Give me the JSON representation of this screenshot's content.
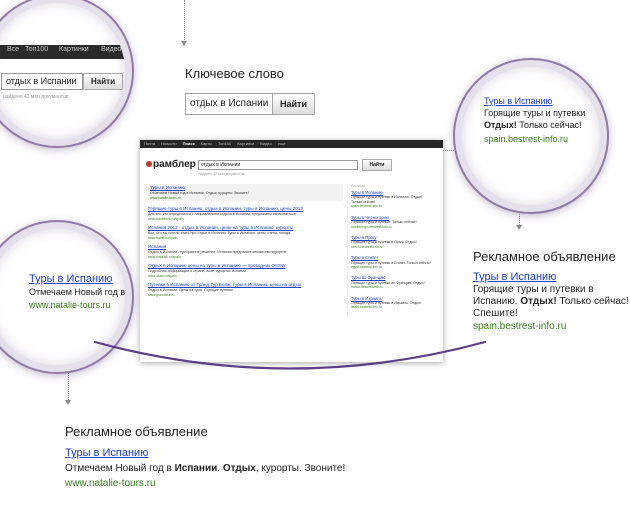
{
  "keyword_section": {
    "caption": "Ключевое слово",
    "search_value": "отдых в Испании",
    "search_button": "Найти"
  },
  "right_ad": {
    "caption": "Рекламное объявление",
    "title": "Туры в Испанию",
    "body_part1": "Горящие туры и путевки в Испанию.",
    "body_bold": "Отдых!",
    "body_part2": "Только сейчас! Спешите!",
    "url": "spain.bestrest-info.ru"
  },
  "bottom_ad": {
    "caption": "Рекламное объявление",
    "title": "Туры в Испанию",
    "body_part1": "Отмечаем Новый год в",
    "body_bold1": "Испании",
    "body_sep": ".",
    "body_bold2": "Отдых",
    "body_part2": ", курорты. Звоните!",
    "url": "www.natalie-tours.ru"
  },
  "circle_top_left": {
    "nav": [
      "Все",
      "Топ100",
      "Картинки",
      "Видео"
    ],
    "search_value": "отдых в Испании",
    "search_button": "Найти",
    "found": "найдено 42 млн документов"
  },
  "circle_right": {
    "title": "Туры в Испанию",
    "line1": "Горящие туры и путевки",
    "line2_bold": "Отдых!",
    "line2": "Только сейчас!",
    "url": "spain.bestrest-info.ru"
  },
  "circle_left": {
    "title": "Туры в Испанию",
    "line1": "Отмечаем Новый год в",
    "url": "www.natalie-tours.ru"
  },
  "screenshot": {
    "topbar": [
      "Почта",
      "Новости",
      "Поиск",
      "Карты",
      "Топ100",
      "Картинки",
      "Видео",
      "ещё"
    ],
    "topbar_active": "Поиск",
    "logo": "рамблер",
    "search_value": "отдых в Испании",
    "search_button": "Найти",
    "found": "Найдено 42 млн документов",
    "results": [
      {
        "title": "Туры в Испанию",
        "snippet": "Отмечаем Новый год в Испании. Отдых, курорты. Звоните!",
        "url": "www.natalie-tours.ru",
        "ad": true
      },
      {
        "title": "Горящие туры в Испанию, отдых в Испании, туры в Испанию, цены 2012",
        "snippet": "Для тех, кто определился с направлением отдыха в Испании, предлагаем ознакомиться",
        "url": "www.travellove.ru/spain"
      },
      {
        "title": "Испания 2012 - отдых в Испании, цены на туры в Испанию, курорты",
        "snippet": "Все, что вы хотели знать про отдых в Испании. Туры в Испанию, цены, отели, погода",
        "url": "www.travel.ru/spain"
      },
      {
        "title": "Испания",
        "snippet": "Отдых в Испании - прекрасное решение. Испания предлагает множество курортов",
        "url": "www.votpusk.ru/spain"
      },
      {
        "title": "Отдых в Испании, цены на туры в Испанию — проводник OSSW",
        "snippet": "Подробная информация о стране, визе, курортах Испании",
        "url": "www.ossw.ru/spain"
      },
      {
        "title": "Путевки в Испанию от Гранд Тур Болж; туры в Испанию, цены на отдых",
        "snippet": "Отдых в Испании. Цены на туры. Горящие путевки",
        "url": "www.grandtour.ru"
      }
    ],
    "right_label": "Реклама",
    "right_ads": [
      {
        "title": "Туры в Испанию",
        "snippet": "Горящие туры и путевки в Испанию. Отдых! Только сейчас!",
        "url": "spain.bestrest-info.ru"
      },
      {
        "title": "Туры в Черногорию",
        "snippet": "Горящие туры и путевки. Только сейчас!",
        "url": "montenegro.bestrest-info.ru"
      },
      {
        "title": "Туры в Прагу",
        "snippet": "Горящие туры и путевки в Прагу. Отдых!",
        "url": "czech.bestrest-info.ru"
      },
      {
        "title": "Туры в Египет",
        "snippet": "Горящие туры и путевки в Египет. Только сейчас!",
        "url": "egypt.bestrest-info.ru"
      },
      {
        "title": "Туры во Францию",
        "snippet": "Горящие туры и путевки во Францию. Отдых!",
        "url": "france.bestrest-info.ru"
      },
      {
        "title": "Туры в Израиль",
        "snippet": "Горящие туры и путевки в Израиль. Отдых!",
        "url": "israel.bestrest-info.ru"
      }
    ]
  },
  "colors": {
    "link": "#1a3dc1",
    "url_green": "#3a7d1e",
    "circle_ring": "#8f7aa8",
    "arc": "#4a2a7a"
  }
}
